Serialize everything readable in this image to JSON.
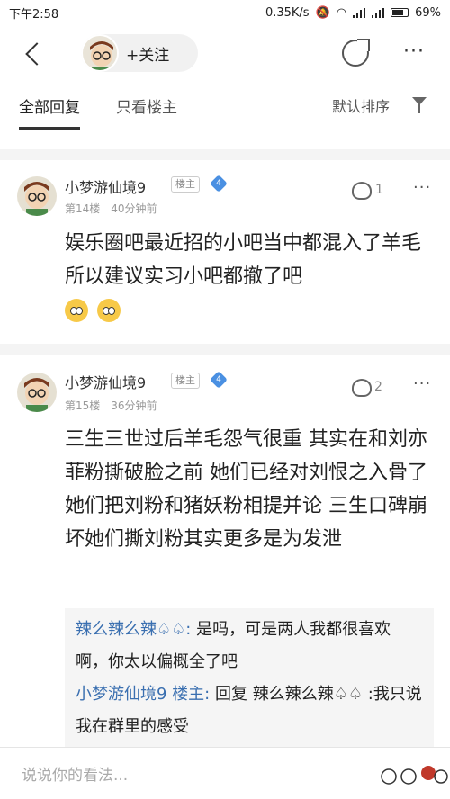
{
  "status_bar": {
    "time": "下午2:58",
    "speed": "0.35K/s",
    "battery": "69%"
  },
  "nav": {
    "follow_label": "+关注",
    "icons": [
      "back-icon",
      "share-icon",
      "more-icon"
    ]
  },
  "tabs": {
    "all": "全部回复",
    "op_only": "只看楼主",
    "sort": "默认排序"
  },
  "posts": [
    {
      "username": "小梦游仙境9",
      "badge": "楼主",
      "level": "4",
      "floor": "第14楼",
      "time": "40分钟前",
      "likes": "1",
      "content": "娱乐圈吧最近招的小吧当中都混入了羊毛 所以建议实习小吧都撤了吧"
    },
    {
      "username": "小梦游仙境9",
      "badge": "楼主",
      "level": "4",
      "floor": "第15楼",
      "time": "36分钟前",
      "likes": "2",
      "content": "三生三世过后羊毛怨气很重 其实在和刘亦菲粉撕破脸之前 她们已经对刘恨之入骨了 她们把刘粉和猪妖粉相提并论 三生口碑崩坏她们撕刘粉其实更多是为发泄"
    }
  ],
  "replies": [
    {
      "name": "辣么辣么辣♤♤:",
      "text": " 是吗，可是两人我都很喜欢啊，你太以偏概全了吧"
    },
    {
      "name": "小梦游仙境9 楼主:",
      "text": " 回复 辣么辣么辣♤♤ :我只说我在群里的感受"
    }
  ],
  "input": {
    "placeholder": "说说你的看法..."
  }
}
